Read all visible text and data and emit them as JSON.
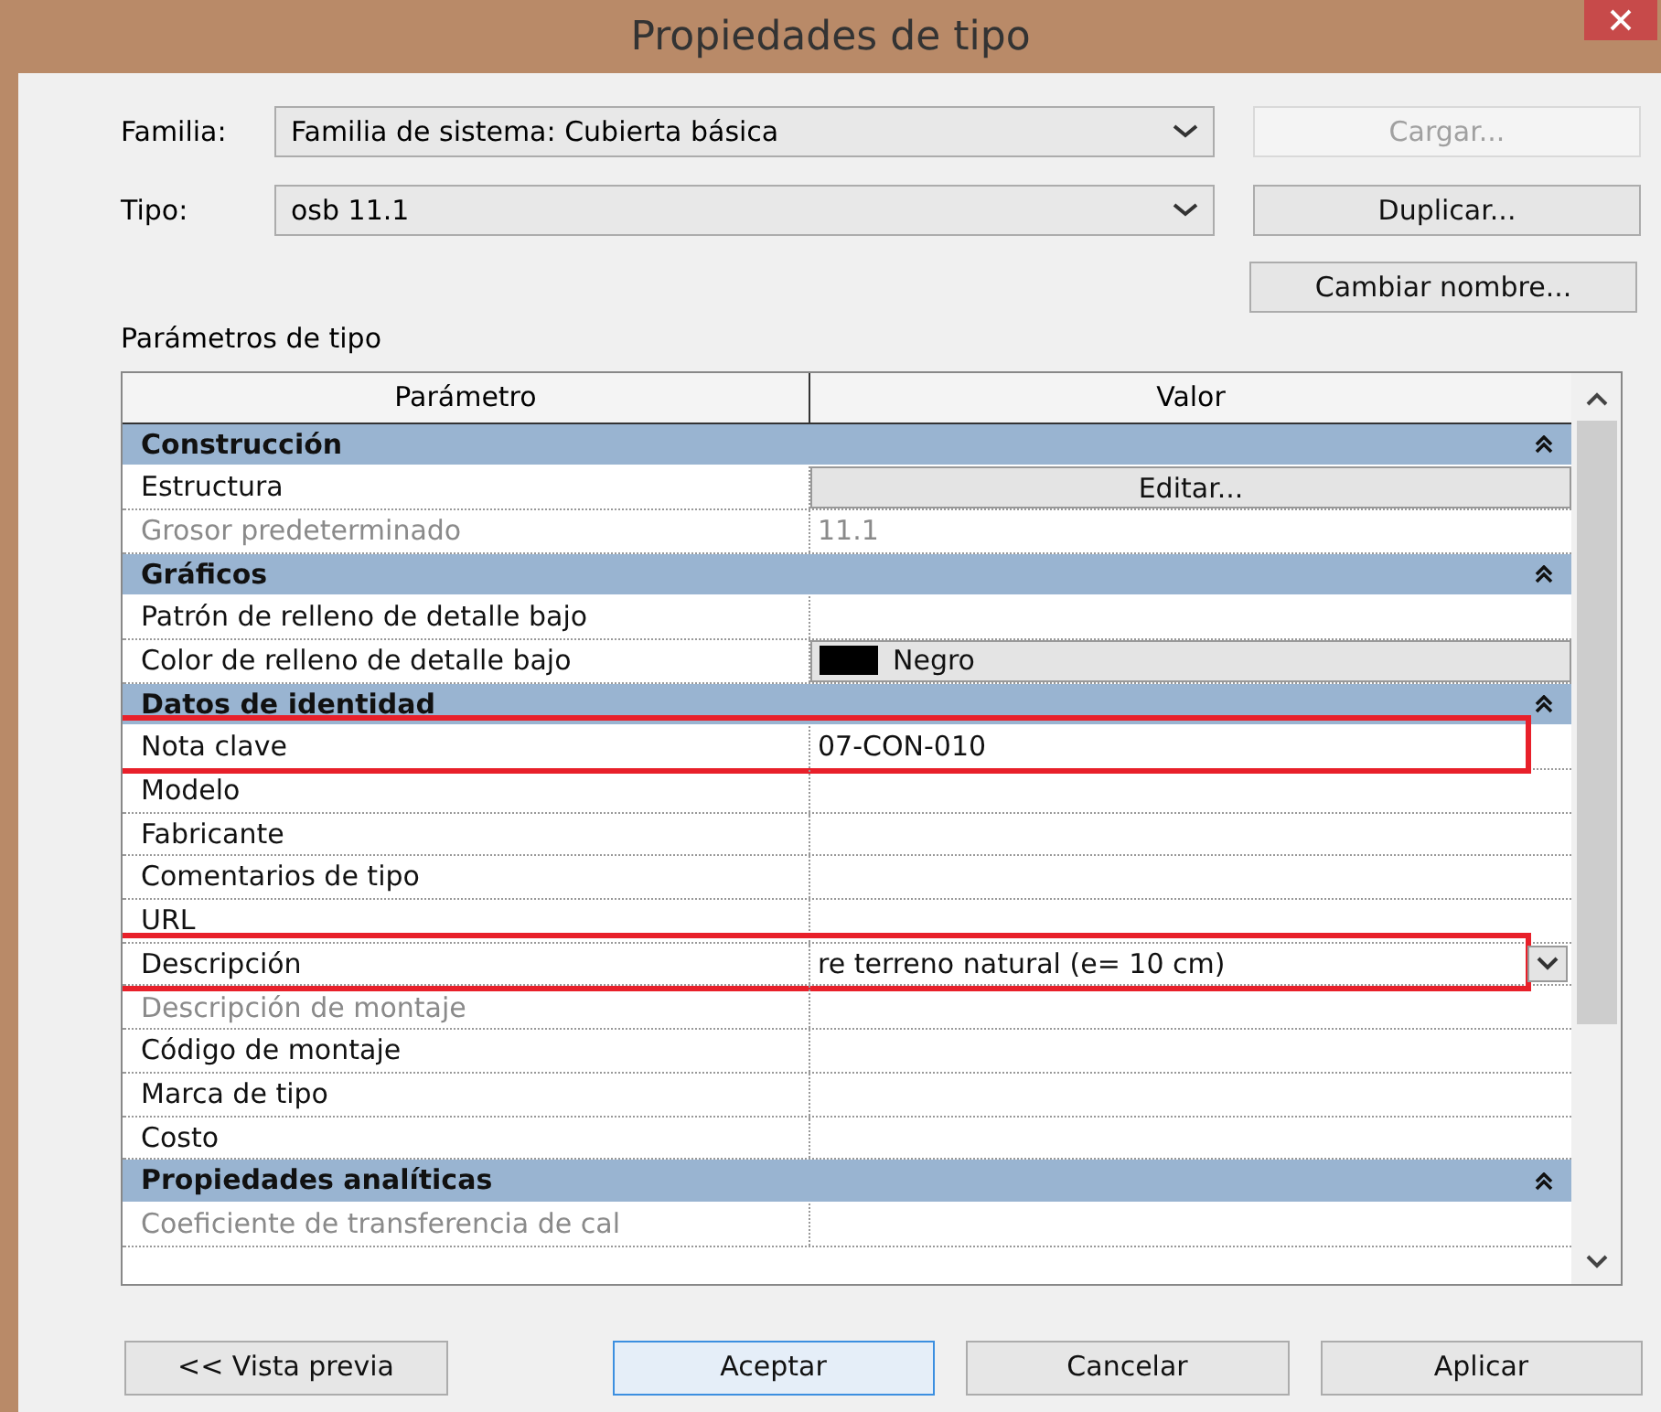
{
  "window": {
    "title": "Propiedades de tipo"
  },
  "familia": {
    "label": "Familia:",
    "value": "Familia de sistema: Cubierta básica"
  },
  "tipo": {
    "label": "Tipo:",
    "value": "osb 11.1"
  },
  "side_buttons": [
    {
      "label": "Cargar...",
      "disabled": true
    },
    {
      "label": "Duplicar...",
      "disabled": false
    },
    {
      "label": "Cambiar nombre...",
      "disabled": false
    }
  ],
  "section_label": "Parámetros de tipo",
  "table": {
    "columns": [
      "Parámetro",
      "Valor"
    ],
    "rows": [
      {
        "kind": "group",
        "label": "Construcción",
        "expanded": true
      },
      {
        "kind": "button",
        "label": "Estructura",
        "value": "Editar...",
        "disabled": false,
        "highlighted": false
      },
      {
        "kind": "text",
        "label": "Grosor predeterminado",
        "value": "11.1",
        "disabled": true,
        "highlighted": false
      },
      {
        "kind": "group",
        "label": "Gráficos",
        "expanded": true
      },
      {
        "kind": "text",
        "label": "Patrón de relleno de detalle bajo",
        "disabled": false,
        "highlighted": false
      },
      {
        "kind": "color",
        "label": "Color de relleno de detalle bajo",
        "value": "Negro",
        "color": "#000000",
        "disabled": false,
        "highlighted": false
      },
      {
        "kind": "group",
        "label": "Datos de identidad",
        "expanded": true
      },
      {
        "kind": "text",
        "label": "Nota clave",
        "value": "07-CON-010",
        "disabled": false,
        "highlighted": true
      },
      {
        "kind": "text",
        "label": "Modelo",
        "disabled": false,
        "highlighted": false
      },
      {
        "kind": "text",
        "label": "Fabricante",
        "disabled": false,
        "highlighted": false
      },
      {
        "kind": "text",
        "label": "Comentarios de tipo",
        "disabled": false,
        "highlighted": false
      },
      {
        "kind": "text",
        "label": "URL",
        "disabled": false,
        "highlighted": false
      },
      {
        "kind": "dropdown",
        "label": "Descripción",
        "value": "re terreno natural (e= 10 cm)",
        "disabled": false,
        "highlighted": true
      },
      {
        "kind": "text",
        "label": "Descripción de montaje",
        "disabled": true,
        "highlighted": false
      },
      {
        "kind": "text",
        "label": "Código de montaje",
        "disabled": false,
        "highlighted": false
      },
      {
        "kind": "text",
        "label": "Marca de tipo",
        "disabled": false,
        "highlighted": false
      },
      {
        "kind": "text",
        "label": "Costo",
        "disabled": false,
        "highlighted": false
      },
      {
        "kind": "group",
        "label": "Propiedades analíticas",
        "expanded": true
      },
      {
        "kind": "text",
        "label": "Coeficiente de transferencia de cal",
        "disabled": true,
        "highlighted": false
      }
    ]
  },
  "footer_buttons": [
    {
      "label": "<< Vista previa",
      "default": false
    },
    {
      "label": "Aceptar",
      "default": true
    },
    {
      "label": "Cancelar",
      "default": false
    },
    {
      "label": "Aplicar",
      "default": false
    }
  ]
}
